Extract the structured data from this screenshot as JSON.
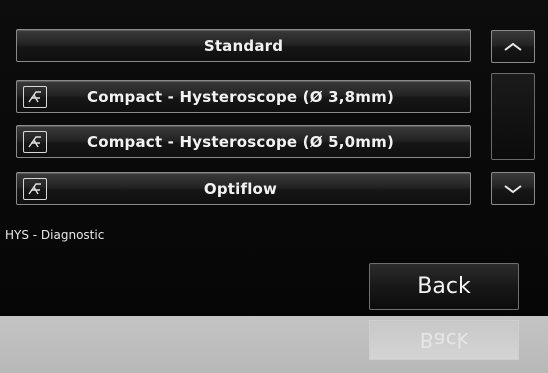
{
  "menu": {
    "items": [
      {
        "label": "Standard",
        "icon": null
      },
      {
        "label": "Compact - Hysteroscope (Ø 3,8mm)",
        "icon": "hysteroscope-icon"
      },
      {
        "label": "Compact - Hysteroscope (Ø 5,0mm)",
        "icon": "hysteroscope-icon"
      },
      {
        "label": "Optiflow",
        "icon": "hysteroscope-icon"
      }
    ]
  },
  "scroll": {
    "up_icon": "chevron-up-icon",
    "down_icon": "chevron-down-icon"
  },
  "context": {
    "label": "HYS - Diagnostic"
  },
  "footer": {
    "back_label": "Back"
  },
  "colors": {
    "background": "#080808",
    "button_border": "#8a8a8a",
    "text": "#f2f2f2",
    "reflection": "#bdbdbd"
  }
}
